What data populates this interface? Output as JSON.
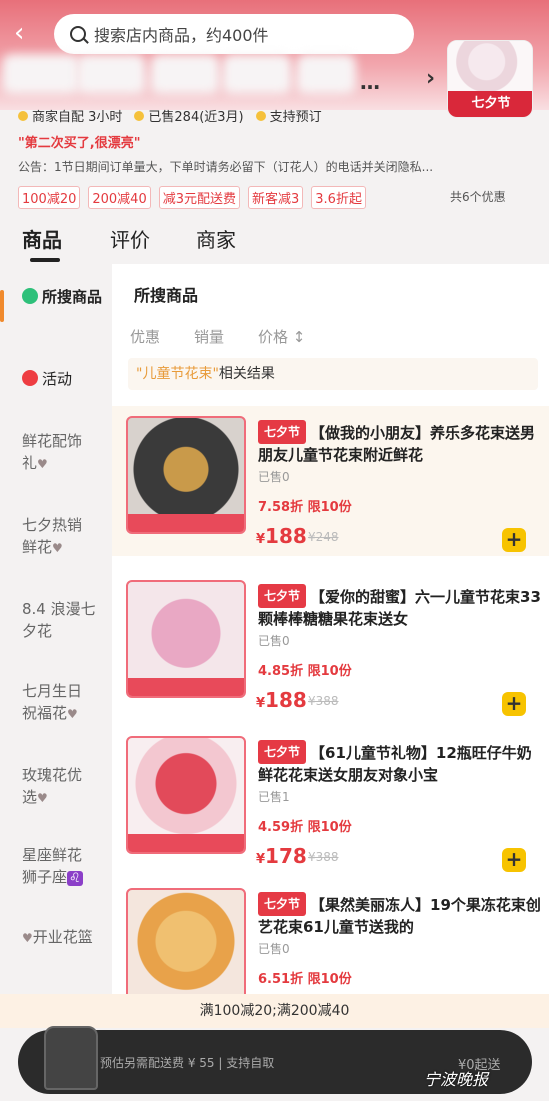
{
  "header": {
    "back_icon": "back-arrow-icon",
    "search_placeholder": "搜索店内商品，约400件",
    "more_dots": "…",
    "chevron": "›",
    "logo_label": "七夕节"
  },
  "store": {
    "meta": [
      "商家自配 3小时",
      "已售284(近3月)",
      "支持预订"
    ],
    "slogan": "\"第二次买了,很漂亮\"",
    "notice": "公告：1节日期间订单量大，下单时请务必留下（订花人）的电话并关闭隐私...",
    "coupons": [
      "100减20",
      "200减40",
      "减3元配送费",
      "新客减3",
      "3.6折起"
    ],
    "coupons_more": "共6个优惠"
  },
  "tabs": [
    "商品",
    "评价",
    "商家"
  ],
  "sidebar": {
    "items": [
      {
        "label": "所搜商品"
      },
      {
        "label": "活动"
      },
      {
        "label": "鲜花配饰礼"
      },
      {
        "label": "七夕热销鲜花"
      },
      {
        "label": "8.4 浪漫七夕花"
      },
      {
        "label": "七月生日祝福花"
      },
      {
        "label": "玫瑰花优选"
      },
      {
        "label": "星座鲜花狮子座"
      },
      {
        "label": "开业花篮"
      }
    ],
    "leo_symbol": "♌"
  },
  "main": {
    "section_title": "所搜商品",
    "sorts": [
      "优惠",
      "销量",
      "价格 ↕"
    ],
    "related_keyword": "\"儿童节花束\"",
    "related_suffix": "相关结果",
    "products": [
      {
        "tag": "七夕节",
        "title": "【做我的小朋友】养乐多花束送男朋友儿童节花束附近鲜花",
        "sold": "已售0",
        "discount": "7.58折 限10份",
        "price": "188",
        "currency": "¥",
        "original": "¥248"
      },
      {
        "tag": "七夕节",
        "title": "【爱你的甜蜜】六一儿童节花束33颗棒棒糖糖果花束送女",
        "sold": "已售0",
        "discount": "4.85折 限10份",
        "price": "188",
        "currency": "¥",
        "original": "¥388"
      },
      {
        "tag": "七夕节",
        "title": "【61儿童节礼物】12瓶旺仔牛奶鲜花花束送女朋友对象小宝",
        "sold": "已售1",
        "discount": "4.59折 限10份",
        "price": "178",
        "currency": "¥",
        "original": "¥388"
      },
      {
        "tag": "七夕节",
        "title": "【果然美丽冻人】19个果冻花束创艺花束61儿童节送我的",
        "sold": "已售0",
        "discount": "6.51折 限10份",
        "price": "",
        "currency": "",
        "original": ""
      }
    ]
  },
  "footer": {
    "promo": "满100减20;满200减40",
    "cart_text": "预估另需配送费 ¥ 55 | 支持自取",
    "start_text": "¥0起送",
    "watermark": "宁波晚报"
  },
  "colors": {
    "accent_red": "#e43a3f",
    "header_pink": "#e8707a",
    "add_yellow": "#f7c300"
  }
}
